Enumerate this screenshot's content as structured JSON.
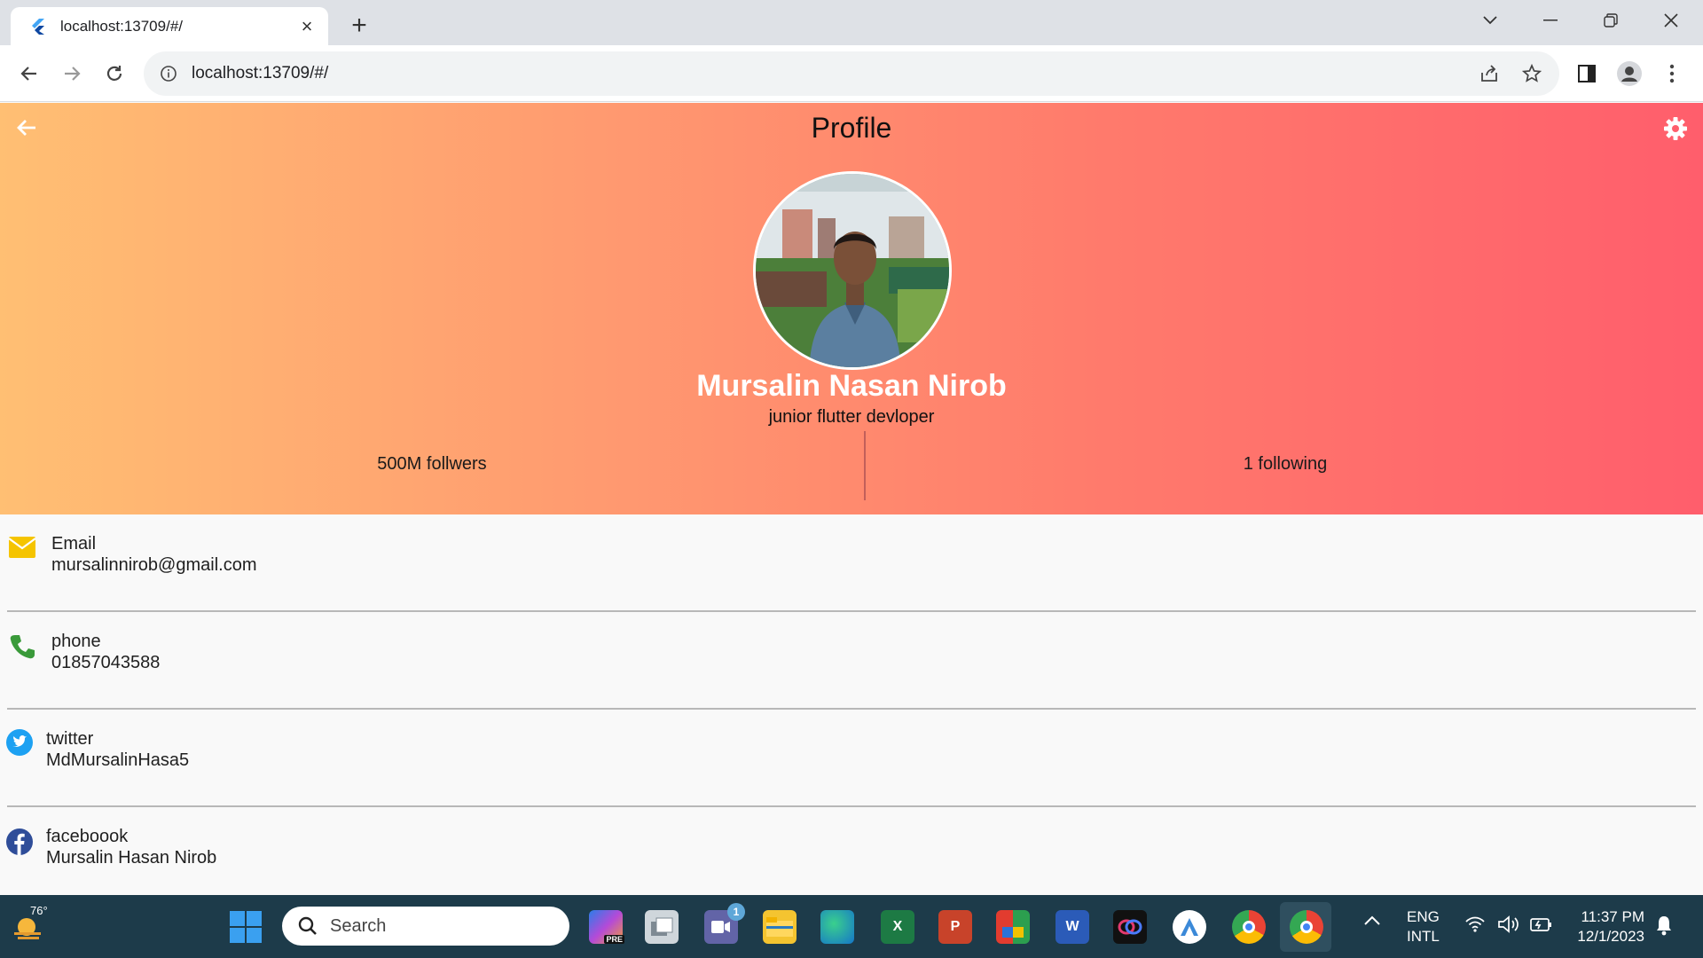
{
  "browser": {
    "tab_title": "localhost:13709/#/",
    "url": "localhost:13709/#/"
  },
  "app": {
    "title": "Profile",
    "name": "Mursalin Nasan Nirob",
    "role": "junior flutter devloper",
    "followers": "500M follwers",
    "following": "1 following",
    "accent_colors": {
      "gradient_start": "#ffbf73",
      "gradient_end": "#ff5e6c"
    },
    "info": [
      {
        "label": "Email",
        "value": "mursalinnirob@gmail.com",
        "icon": "mail-icon",
        "color": "#f5c400"
      },
      {
        "label": "phone",
        "value": "01857043588",
        "icon": "phone-icon",
        "color": "#3a9a3a"
      },
      {
        "label": "twitter",
        "value": "MdMursalinHasa5",
        "icon": "twitter-icon",
        "color": "#1da1f2"
      },
      {
        "label": "faceboook",
        "value": "Mursalin Hasan Nirob",
        "icon": "facebook-icon",
        "color": "#2f4d99"
      }
    ]
  },
  "taskbar": {
    "weather_temp": "76°",
    "search_placeholder": "Search",
    "chat_badge": "1",
    "lang_line1": "ENG",
    "lang_line2": "INTL",
    "time": "11:37 PM",
    "date": "12/1/2023"
  }
}
